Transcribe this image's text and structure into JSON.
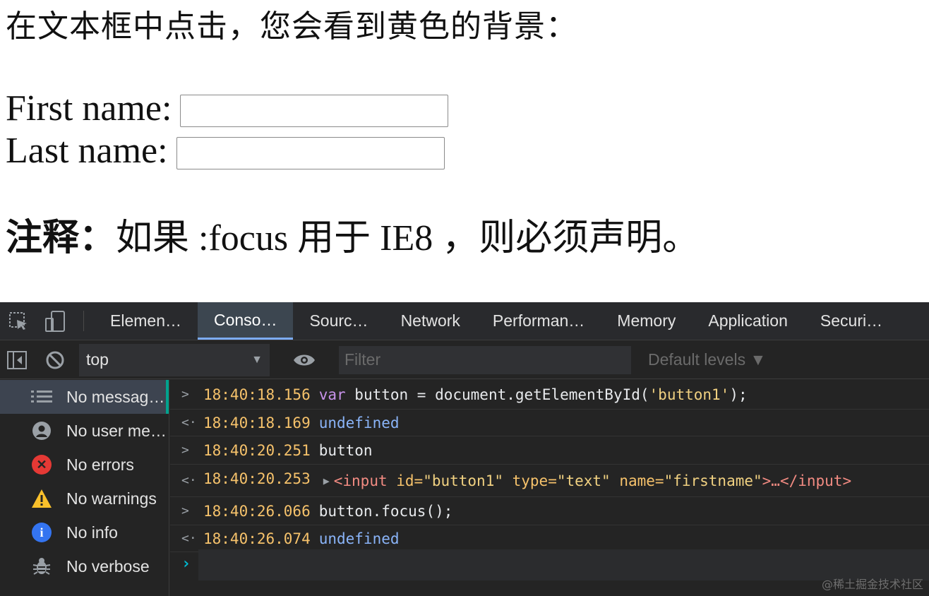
{
  "page": {
    "heading": "在文本框中点击，您会看到黄色的背景：",
    "first_label": "First name:",
    "last_label": "Last name:",
    "note_bold": "注释：",
    "note_a": "如果",
    "note_b": " :focus ",
    "note_c": "用于",
    "note_d": " IE8 ",
    "note_e": "，则必须声明",
    "note_f": "。"
  },
  "devtools": {
    "tabs": [
      "Elemen…",
      "Conso…",
      "Sourc…",
      "Network",
      "Performan…",
      "Memory",
      "Application",
      "Securi…"
    ],
    "active_tab": "Conso…",
    "context": "top",
    "filter_placeholder": "Filter",
    "levels": "Default levels ▼",
    "sidebar": [
      {
        "label": "No messag…",
        "icon": "list-icon"
      },
      {
        "label": "No user me…",
        "icon": "user-icon"
      },
      {
        "label": "No errors",
        "icon": "error-icon",
        "color": "#e53935"
      },
      {
        "label": "No warnings",
        "icon": "warning-icon",
        "color": "#f9c02b"
      },
      {
        "label": "No info",
        "icon": "info-icon",
        "color": "#3474f0"
      },
      {
        "label": "No verbose",
        "icon": "bug-icon"
      }
    ],
    "lines": [
      {
        "ts": "18:40:18.156",
        "dir": ">"
      },
      {
        "ts": "18:40:18.169",
        "dir": "<",
        "text": "undefined"
      },
      {
        "ts": "18:40:20.251",
        "dir": ">",
        "text": "button"
      },
      {
        "ts": "18:40:20.253",
        "dir": "<"
      },
      {
        "ts": "18:40:26.066",
        "dir": ">",
        "text": "button.focus();"
      },
      {
        "ts": "18:40:26.074",
        "dir": "<",
        "text": "undefined"
      }
    ],
    "line0": {
      "kw": "var",
      "mid": " button = document.getElementById(",
      "str": "'button1'",
      "end": ");"
    },
    "line3": {
      "open": "<input",
      "a1": " id=",
      "v1": "\"button1\"",
      "a2": " type=",
      "v2": "\"text\"",
      "a3": " name=",
      "v3": "\"firstname\"",
      "mid": ">…",
      "close": "</input>"
    }
  },
  "watermark": "@稀土掘金技术社区"
}
